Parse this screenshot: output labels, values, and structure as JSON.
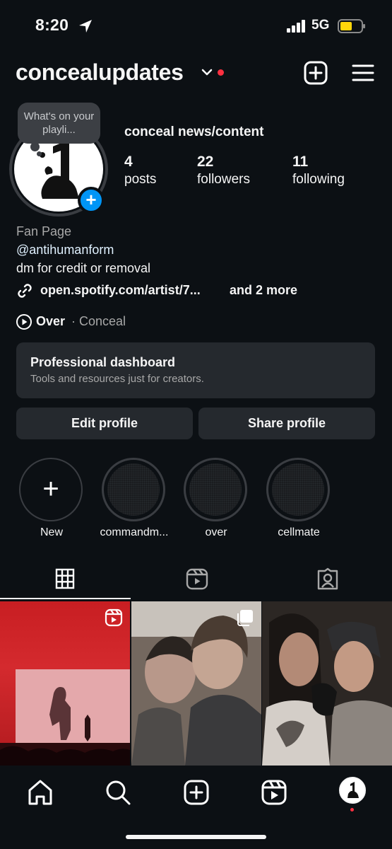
{
  "status_bar": {
    "time": "8:20",
    "network": "5G",
    "battery_color": "#ffd60a"
  },
  "header": {
    "username": "concealupdates"
  },
  "profile": {
    "note": "What's on your playli...",
    "display_name": "conceal news/content",
    "stats": [
      {
        "value": "4",
        "label": "posts"
      },
      {
        "value": "22",
        "label": "followers"
      },
      {
        "value": "11",
        "label": "following"
      }
    ],
    "category": "Fan Page",
    "mention": "@antihumanform",
    "bio": "dm for credit or removal",
    "link": "open.spotify.com/artist/7...",
    "link_more": "and 2 more",
    "music_title": "Over",
    "music_artist": "· Conceal"
  },
  "dashboard": {
    "title": "Professional dashboard",
    "subtitle": "Tools and resources just for creators."
  },
  "buttons": {
    "edit": "Edit profile",
    "share": "Share profile"
  },
  "highlights": [
    {
      "label": "New"
    },
    {
      "label": "commandm..."
    },
    {
      "label": "over"
    },
    {
      "label": "cellmate"
    }
  ],
  "tabs": {
    "active": "posts-grid",
    "items": [
      "grid-icon",
      "reels-icon",
      "tagged-icon"
    ]
  },
  "posts": [
    {
      "type": "reel",
      "badge_icon": "reels-icon"
    },
    {
      "type": "carousel",
      "badge_icon": "carousel-icon"
    },
    {
      "type": "photo"
    }
  ],
  "bottom_nav": [
    "home-icon",
    "search-icon",
    "create-icon",
    "reels-icon",
    "profile-avatar"
  ],
  "colors": {
    "background": "#0c1014",
    "accent": "#0095f6",
    "notification": "#ff3040",
    "surface": "#25292e"
  }
}
